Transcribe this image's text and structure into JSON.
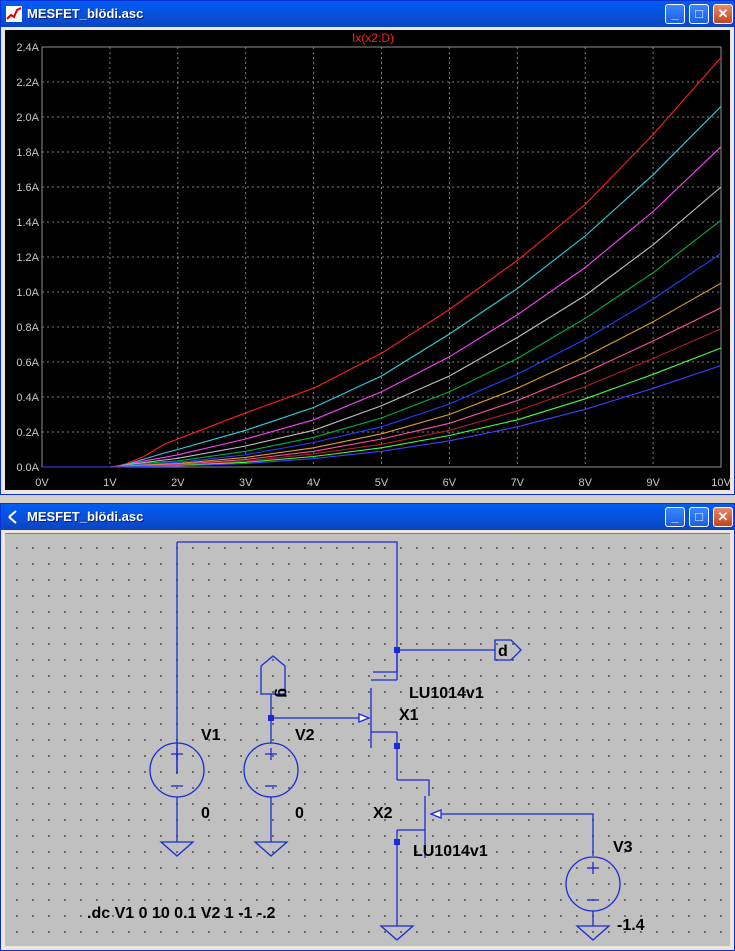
{
  "plot_window": {
    "title": "MESFET_blödi.asc",
    "trace_label": "Ix(x2:D)",
    "controls": {
      "minimize": "_",
      "maximize": "□",
      "close": "✕"
    }
  },
  "schematic_window": {
    "title": "MESFET_blödi.asc",
    "controls": {
      "minimize": "_",
      "maximize": "□",
      "close": "✕"
    },
    "components": {
      "v1_name": "V1",
      "v1_value": "0",
      "v2_name": "V2",
      "v2_value": "0",
      "v3_name": "V3",
      "v3_value": "-1.4",
      "x1_name": "X1",
      "x1_model": "LU1014v1",
      "x2_name": "X2",
      "x2_model": "LU1014v1",
      "label_d": "d",
      "label_g": "g"
    },
    "directive": ".dc V1 0 10 0.1 V2 1 -1 -.2"
  },
  "chart_data": {
    "type": "line",
    "title": "Ix(x2:D)",
    "xlabel": "",
    "ylabel": "",
    "xlim": [
      0,
      10
    ],
    "ylim": [
      0,
      2.4
    ],
    "grid": true,
    "x_ticks": [
      "0V",
      "1V",
      "2V",
      "3V",
      "4V",
      "5V",
      "6V",
      "7V",
      "8V",
      "9V",
      "10V"
    ],
    "y_ticks": [
      "0.0A",
      "0.2A",
      "0.4A",
      "0.6A",
      "0.8A",
      "1.0A",
      "1.2A",
      "1.4A",
      "1.6A",
      "1.8A",
      "2.0A",
      "2.2A",
      "2.4A"
    ],
    "x": [
      0,
      1,
      1.1,
      1.25,
      1.5,
      1.8,
      2,
      3,
      4,
      5,
      6,
      7,
      8,
      9,
      10
    ],
    "series": [
      {
        "color": "#ff2020",
        "values": [
          0,
          0,
          0.005,
          0.02,
          0.06,
          0.13,
          0.16,
          0.31,
          0.45,
          0.65,
          0.9,
          1.18,
          1.5,
          1.9,
          2.34
        ]
      },
      {
        "color": "#30d0e0",
        "values": [
          0,
          0,
          0.004,
          0.015,
          0.045,
          0.08,
          0.1,
          0.21,
          0.34,
          0.52,
          0.76,
          1.02,
          1.32,
          1.67,
          2.06
        ]
      },
      {
        "color": "#ff40ff",
        "values": [
          0,
          0,
          0.003,
          0.012,
          0.035,
          0.055,
          0.07,
          0.16,
          0.27,
          0.43,
          0.63,
          0.87,
          1.14,
          1.46,
          1.83
        ]
      },
      {
        "color": "#c0c0c0",
        "values": [
          0,
          0,
          0.003,
          0.01,
          0.025,
          0.04,
          0.05,
          0.12,
          0.21,
          0.35,
          0.52,
          0.74,
          0.98,
          1.27,
          1.6
        ]
      },
      {
        "color": "#00b040",
        "values": [
          0,
          0,
          0.002,
          0.008,
          0.02,
          0.03,
          0.035,
          0.09,
          0.17,
          0.28,
          0.43,
          0.62,
          0.85,
          1.11,
          1.41
        ]
      },
      {
        "color": "#2040ff",
        "values": [
          0,
          0,
          0.002,
          0.006,
          0.015,
          0.022,
          0.026,
          0.07,
          0.14,
          0.23,
          0.36,
          0.53,
          0.73,
          0.96,
          1.22
        ]
      },
      {
        "color": "#e0a020",
        "values": [
          0,
          0,
          0.001,
          0.005,
          0.011,
          0.016,
          0.02,
          0.055,
          0.11,
          0.19,
          0.3,
          0.45,
          0.63,
          0.83,
          1.05
        ]
      },
      {
        "color": "#ff50a0",
        "values": [
          0,
          0,
          0.001,
          0.004,
          0.008,
          0.012,
          0.015,
          0.043,
          0.09,
          0.16,
          0.25,
          0.38,
          0.54,
          0.72,
          0.91
        ]
      },
      {
        "color": "#b02020",
        "values": [
          0,
          0,
          0.001,
          0.003,
          0.006,
          0.009,
          0.011,
          0.034,
          0.075,
          0.13,
          0.21,
          0.32,
          0.46,
          0.62,
          0.79
        ]
      },
      {
        "color": "#40ff40",
        "values": [
          0,
          0,
          0,
          0.002,
          0.004,
          0.007,
          0.008,
          0.027,
          0.06,
          0.11,
          0.18,
          0.27,
          0.39,
          0.53,
          0.68
        ]
      },
      {
        "color": "#4040ff",
        "values": [
          0,
          0,
          0,
          0.001,
          0.003,
          0.005,
          0.006,
          0.02,
          0.048,
          0.09,
          0.15,
          0.23,
          0.33,
          0.45,
          0.58
        ]
      }
    ]
  }
}
